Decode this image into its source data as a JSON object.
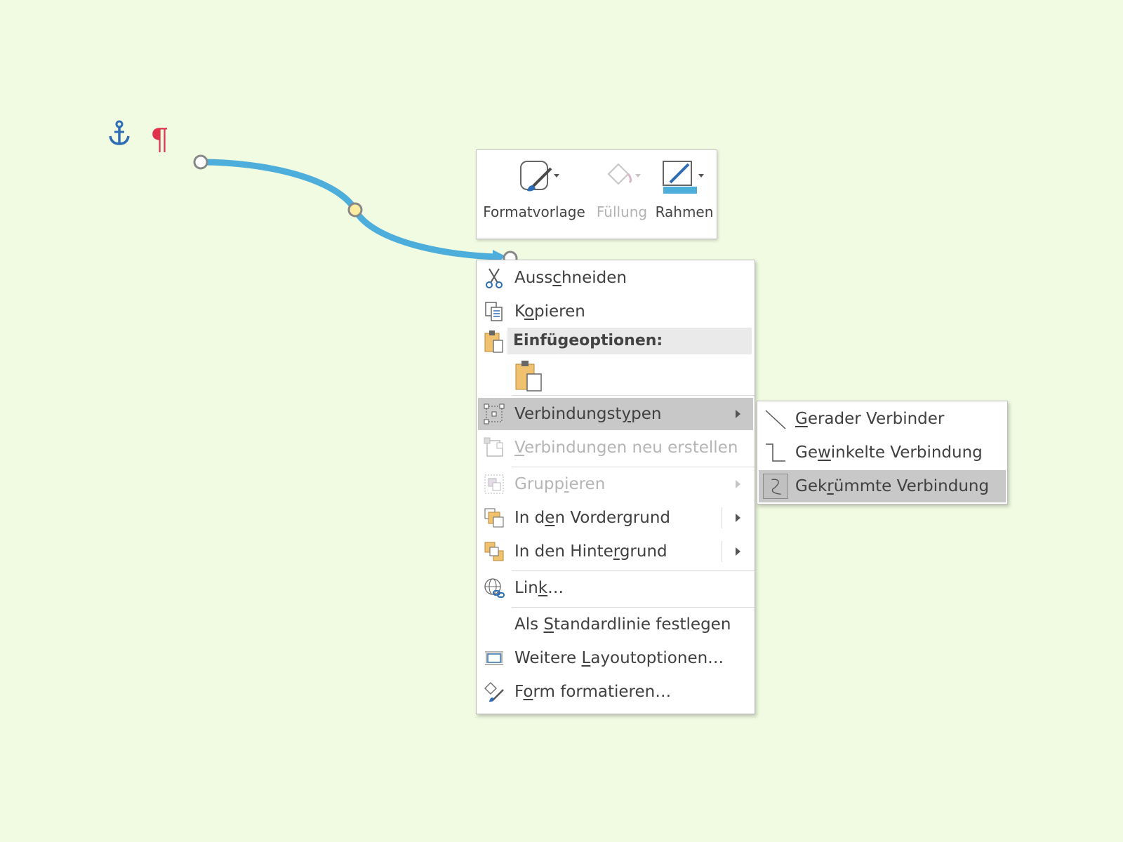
{
  "canvas": {
    "connector_color": "#4eaedb",
    "anchor_color": "#2e6db4",
    "pilcrow_color": "#e0324b",
    "pilcrow": "¶",
    "anchor_glyph": "⚓"
  },
  "minibar": {
    "buttons": [
      {
        "label": "Formatvorlage",
        "icon": "shape-style-icon",
        "disabled": false
      },
      {
        "label": "Füllung",
        "icon": "fill-bucket-icon",
        "disabled": true
      },
      {
        "label": "Rahmen",
        "icon": "outline-pen-icon",
        "disabled": false
      }
    ]
  },
  "context_menu": {
    "cut": {
      "pre": "Auss",
      "key": "c",
      "post": "hneiden",
      "icon": "scissors-icon"
    },
    "copy": {
      "pre": "K",
      "key": "o",
      "post": "pieren",
      "icon": "copy-icon"
    },
    "paste_header": "Einfügeoptionen:",
    "paste_option_icon": "paste-keep-formatting-icon",
    "connector_types": {
      "pre": "Verbindungst",
      "key": "y",
      "post": "pen",
      "icon": "connector-types-icon"
    },
    "reroute": {
      "pre": "",
      "key": "V",
      "post": "erbindungen neu erstellen",
      "icon": "reroute-connectors-icon"
    },
    "group": {
      "pre": "Grupp",
      "key": "i",
      "post": "eren",
      "icon": "group-icon"
    },
    "bring_front": {
      "pre": "In d",
      "key": "e",
      "post": "n Vordergrund",
      "icon": "bring-to-front-icon"
    },
    "send_back": {
      "pre": "In den Hinte",
      "key": "r",
      "post": "grund",
      "icon": "send-to-back-icon"
    },
    "link": {
      "pre": "Lin",
      "key": "k",
      "post": "…",
      "icon": "link-icon"
    },
    "set_default": {
      "pre": "Als ",
      "key": "S",
      "post": "tandardlinie festlegen"
    },
    "layout": {
      "pre": "Weitere ",
      "key": "L",
      "post": "ayoutoptionen…",
      "icon": "layout-options-icon"
    },
    "format_shape": {
      "pre": "F",
      "key": "o",
      "post": "rm formatieren…",
      "icon": "format-shape-icon"
    }
  },
  "submenu": {
    "items": [
      {
        "pre": "",
        "key": "G",
        "post": "erader Verbinder",
        "icon": "straight-connector-icon"
      },
      {
        "pre": "Ge",
        "key": "w",
        "post": "inkelte Verbindung",
        "icon": "elbow-connector-icon"
      },
      {
        "pre": "Gek",
        "key": "r",
        "post": "ümmte Verbindung",
        "icon": "curved-connector-icon"
      }
    ]
  }
}
